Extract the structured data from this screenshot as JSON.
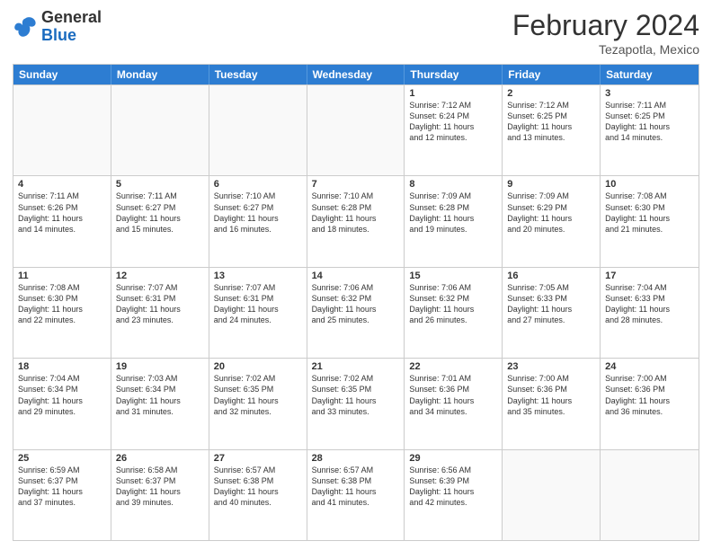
{
  "header": {
    "logo_general": "General",
    "logo_blue": "Blue",
    "month_title": "February 2024",
    "location": "Tezapotla, Mexico"
  },
  "calendar": {
    "days": [
      "Sunday",
      "Monday",
      "Tuesday",
      "Wednesday",
      "Thursday",
      "Friday",
      "Saturday"
    ],
    "rows": [
      [
        {
          "num": "",
          "text": "",
          "empty": true
        },
        {
          "num": "",
          "text": "",
          "empty": true
        },
        {
          "num": "",
          "text": "",
          "empty": true
        },
        {
          "num": "",
          "text": "",
          "empty": true
        },
        {
          "num": "1",
          "text": "Sunrise: 7:12 AM\nSunset: 6:24 PM\nDaylight: 11 hours\nand 12 minutes.",
          "empty": false
        },
        {
          "num": "2",
          "text": "Sunrise: 7:12 AM\nSunset: 6:25 PM\nDaylight: 11 hours\nand 13 minutes.",
          "empty": false
        },
        {
          "num": "3",
          "text": "Sunrise: 7:11 AM\nSunset: 6:25 PM\nDaylight: 11 hours\nand 14 minutes.",
          "empty": false
        }
      ],
      [
        {
          "num": "4",
          "text": "Sunrise: 7:11 AM\nSunset: 6:26 PM\nDaylight: 11 hours\nand 14 minutes.",
          "empty": false
        },
        {
          "num": "5",
          "text": "Sunrise: 7:11 AM\nSunset: 6:27 PM\nDaylight: 11 hours\nand 15 minutes.",
          "empty": false
        },
        {
          "num": "6",
          "text": "Sunrise: 7:10 AM\nSunset: 6:27 PM\nDaylight: 11 hours\nand 16 minutes.",
          "empty": false
        },
        {
          "num": "7",
          "text": "Sunrise: 7:10 AM\nSunset: 6:28 PM\nDaylight: 11 hours\nand 18 minutes.",
          "empty": false
        },
        {
          "num": "8",
          "text": "Sunrise: 7:09 AM\nSunset: 6:28 PM\nDaylight: 11 hours\nand 19 minutes.",
          "empty": false
        },
        {
          "num": "9",
          "text": "Sunrise: 7:09 AM\nSunset: 6:29 PM\nDaylight: 11 hours\nand 20 minutes.",
          "empty": false
        },
        {
          "num": "10",
          "text": "Sunrise: 7:08 AM\nSunset: 6:30 PM\nDaylight: 11 hours\nand 21 minutes.",
          "empty": false
        }
      ],
      [
        {
          "num": "11",
          "text": "Sunrise: 7:08 AM\nSunset: 6:30 PM\nDaylight: 11 hours\nand 22 minutes.",
          "empty": false
        },
        {
          "num": "12",
          "text": "Sunrise: 7:07 AM\nSunset: 6:31 PM\nDaylight: 11 hours\nand 23 minutes.",
          "empty": false
        },
        {
          "num": "13",
          "text": "Sunrise: 7:07 AM\nSunset: 6:31 PM\nDaylight: 11 hours\nand 24 minutes.",
          "empty": false
        },
        {
          "num": "14",
          "text": "Sunrise: 7:06 AM\nSunset: 6:32 PM\nDaylight: 11 hours\nand 25 minutes.",
          "empty": false
        },
        {
          "num": "15",
          "text": "Sunrise: 7:06 AM\nSunset: 6:32 PM\nDaylight: 11 hours\nand 26 minutes.",
          "empty": false
        },
        {
          "num": "16",
          "text": "Sunrise: 7:05 AM\nSunset: 6:33 PM\nDaylight: 11 hours\nand 27 minutes.",
          "empty": false
        },
        {
          "num": "17",
          "text": "Sunrise: 7:04 AM\nSunset: 6:33 PM\nDaylight: 11 hours\nand 28 minutes.",
          "empty": false
        }
      ],
      [
        {
          "num": "18",
          "text": "Sunrise: 7:04 AM\nSunset: 6:34 PM\nDaylight: 11 hours\nand 29 minutes.",
          "empty": false
        },
        {
          "num": "19",
          "text": "Sunrise: 7:03 AM\nSunset: 6:34 PM\nDaylight: 11 hours\nand 31 minutes.",
          "empty": false
        },
        {
          "num": "20",
          "text": "Sunrise: 7:02 AM\nSunset: 6:35 PM\nDaylight: 11 hours\nand 32 minutes.",
          "empty": false
        },
        {
          "num": "21",
          "text": "Sunrise: 7:02 AM\nSunset: 6:35 PM\nDaylight: 11 hours\nand 33 minutes.",
          "empty": false
        },
        {
          "num": "22",
          "text": "Sunrise: 7:01 AM\nSunset: 6:36 PM\nDaylight: 11 hours\nand 34 minutes.",
          "empty": false
        },
        {
          "num": "23",
          "text": "Sunrise: 7:00 AM\nSunset: 6:36 PM\nDaylight: 11 hours\nand 35 minutes.",
          "empty": false
        },
        {
          "num": "24",
          "text": "Sunrise: 7:00 AM\nSunset: 6:36 PM\nDaylight: 11 hours\nand 36 minutes.",
          "empty": false
        }
      ],
      [
        {
          "num": "25",
          "text": "Sunrise: 6:59 AM\nSunset: 6:37 PM\nDaylight: 11 hours\nand 37 minutes.",
          "empty": false
        },
        {
          "num": "26",
          "text": "Sunrise: 6:58 AM\nSunset: 6:37 PM\nDaylight: 11 hours\nand 39 minutes.",
          "empty": false
        },
        {
          "num": "27",
          "text": "Sunrise: 6:57 AM\nSunset: 6:38 PM\nDaylight: 11 hours\nand 40 minutes.",
          "empty": false
        },
        {
          "num": "28",
          "text": "Sunrise: 6:57 AM\nSunset: 6:38 PM\nDaylight: 11 hours\nand 41 minutes.",
          "empty": false
        },
        {
          "num": "29",
          "text": "Sunrise: 6:56 AM\nSunset: 6:39 PM\nDaylight: 11 hours\nand 42 minutes.",
          "empty": false
        },
        {
          "num": "",
          "text": "",
          "empty": true
        },
        {
          "num": "",
          "text": "",
          "empty": true
        }
      ]
    ]
  }
}
